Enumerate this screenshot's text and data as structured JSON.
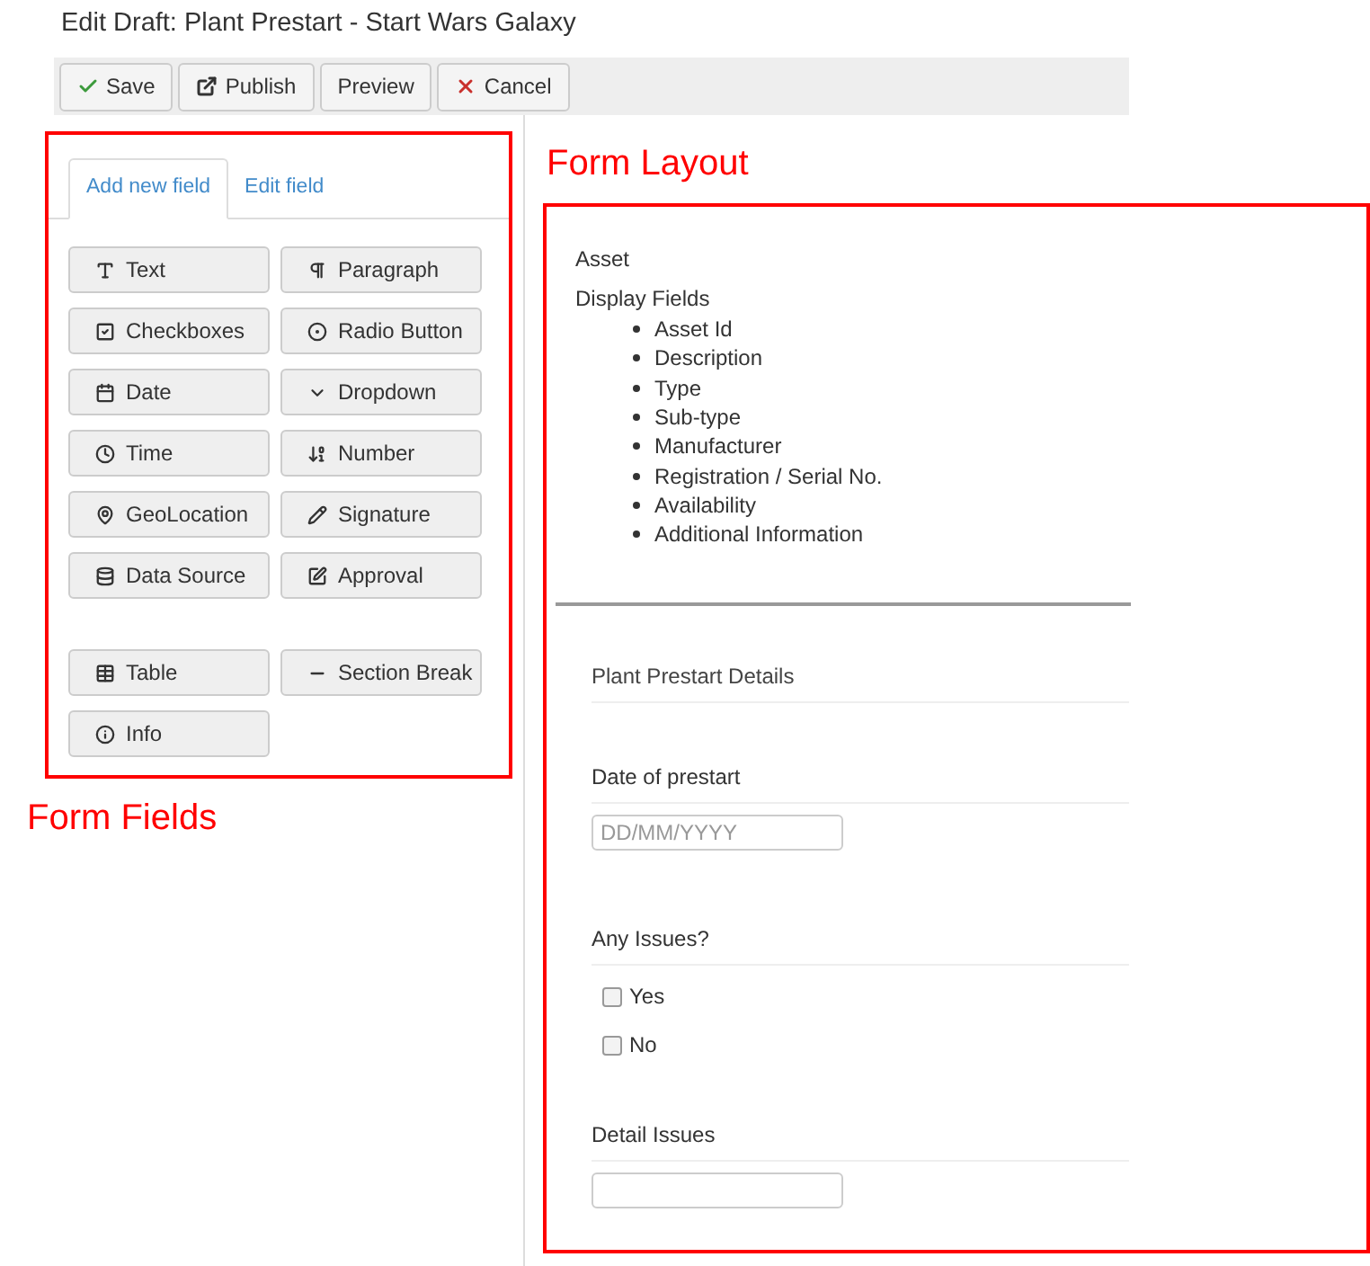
{
  "page_title": "Edit Draft: Plant Prestart - Start Wars Galaxy",
  "toolbar": [
    "Save",
    "Publish",
    "Preview",
    "Cancel"
  ],
  "tabs": [
    {
      "label": "Add new field",
      "selected": true
    },
    {
      "label": "Edit field",
      "selected": false
    }
  ],
  "field_groups": [
    [
      "Text",
      "Paragraph",
      "Checkboxes",
      "Radio Button",
      "Date",
      "Dropdown",
      "Time",
      "Number",
      "GeoLocation",
      "Signature",
      "Data Source",
      "Approval"
    ],
    [
      "Table",
      "Section Break",
      "Info"
    ]
  ],
  "annotations": {
    "fields": "Form Fields",
    "layout": "Form Layout"
  },
  "asset": {
    "label": "Asset",
    "display_label": "Display Fields",
    "display_fields": [
      "Asset Id",
      "Description",
      "Type",
      "Sub-type",
      "Manufacturer",
      "Registration / Serial No.",
      "Availability",
      "Additional Information"
    ]
  },
  "sections": [
    {
      "kind": "header",
      "label": "Plant Prestart Details"
    },
    {
      "kind": "input",
      "label": "Date of prestart",
      "placeholder": "DD/MM/YYYY"
    },
    {
      "kind": "checkboxes",
      "label": "Any Issues?",
      "options": [
        {
          "label": "Yes",
          "checked": false
        },
        {
          "label": "No",
          "checked": false
        }
      ]
    },
    {
      "kind": "input",
      "label": "Detail Issues"
    }
  ]
}
